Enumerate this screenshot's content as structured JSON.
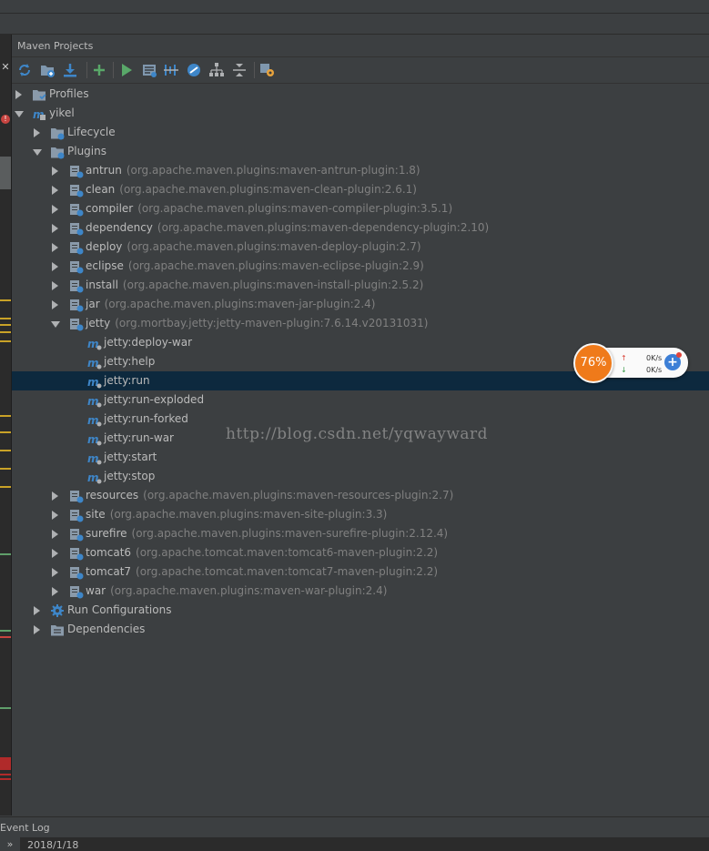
{
  "panel": {
    "title": "Maven Projects"
  },
  "toolbar": [
    {
      "name": "reimport-icon",
      "color": "#3e86c8"
    },
    {
      "name": "add-maven-projects-icon",
      "color": "#3e86c8"
    },
    {
      "name": "download-sources-icon",
      "color": "#3e86c8"
    },
    {
      "name": "add-icon",
      "color": "#59a869"
    },
    {
      "name": "run-icon",
      "color": "#59a869"
    },
    {
      "name": "execute-goal-icon",
      "color": "#3e86c8"
    },
    {
      "name": "toggle-offline-icon",
      "color": "#3e86c8"
    },
    {
      "name": "skip-tests-icon",
      "color": "#3e86c8"
    },
    {
      "name": "show-dependencies-icon",
      "color": "#afb1b3"
    },
    {
      "name": "collapse-all-icon",
      "color": "#afb1b3"
    },
    {
      "name": "settings-icon",
      "color": "#e8a33d"
    }
  ],
  "tree": {
    "profiles": "Profiles",
    "project": "yikel",
    "lifecycle": "Lifecycle",
    "plugins": "Plugins",
    "plugins_before_jetty": [
      {
        "name": "antrun",
        "coord": "(org.apache.maven.plugins:maven-antrun-plugin:1.8)"
      },
      {
        "name": "clean",
        "coord": "(org.apache.maven.plugins:maven-clean-plugin:2.6.1)"
      },
      {
        "name": "compiler",
        "coord": "(org.apache.maven.plugins:maven-compiler-plugin:3.5.1)"
      },
      {
        "name": "dependency",
        "coord": "(org.apache.maven.plugins:maven-dependency-plugin:2.10)"
      },
      {
        "name": "deploy",
        "coord": "(org.apache.maven.plugins:maven-deploy-plugin:2.7)"
      },
      {
        "name": "eclipse",
        "coord": "(org.apache.maven.plugins:maven-eclipse-plugin:2.9)"
      },
      {
        "name": "install",
        "coord": "(org.apache.maven.plugins:maven-install-plugin:2.5.2)"
      },
      {
        "name": "jar",
        "coord": "(org.apache.maven.plugins:maven-jar-plugin:2.4)"
      }
    ],
    "jetty": {
      "name": "jetty",
      "coord": "(org.mortbay.jetty:jetty-maven-plugin:7.6.14.v20131031)"
    },
    "jetty_goals": [
      "jetty:deploy-war",
      "jetty:help",
      "jetty:run",
      "jetty:run-exploded",
      "jetty:run-forked",
      "jetty:run-war",
      "jetty:start",
      "jetty:stop"
    ],
    "selected_goal": "jetty:run",
    "plugins_after_jetty": [
      {
        "name": "resources",
        "coord": "(org.apache.maven.plugins:maven-resources-plugin:2.7)"
      },
      {
        "name": "site",
        "coord": "(org.apache.maven.plugins:maven-site-plugin:3.3)"
      },
      {
        "name": "surefire",
        "coord": "(org.apache.maven.plugins:maven-surefire-plugin:2.12.4)"
      },
      {
        "name": "tomcat6",
        "coord": "(org.apache.tomcat.maven:tomcat6-maven-plugin:2.2)"
      },
      {
        "name": "tomcat7",
        "coord": "(org.apache.tomcat.maven:tomcat7-maven-plugin:2.2)"
      },
      {
        "name": "war",
        "coord": "(org.apache.maven.plugins:maven-war-plugin:2.4)"
      }
    ],
    "run_configurations": "Run Configurations",
    "dependencies": "Dependencies"
  },
  "watermark": "http://blog.csdn.net/yqwayward",
  "net_widget": {
    "percent": "76%",
    "upload": "0K/s",
    "download": "0K/s"
  },
  "event_log": {
    "title": "Event Log",
    "expand": "»",
    "date": "2018/1/18"
  },
  "colors": {
    "background": "#3c3f41",
    "selection": "#0d293e",
    "text": "#bbbbbb",
    "secondary_text": "#808080",
    "maven_blue": "#3e86c8",
    "widget_orange": "#ef7a1a"
  }
}
